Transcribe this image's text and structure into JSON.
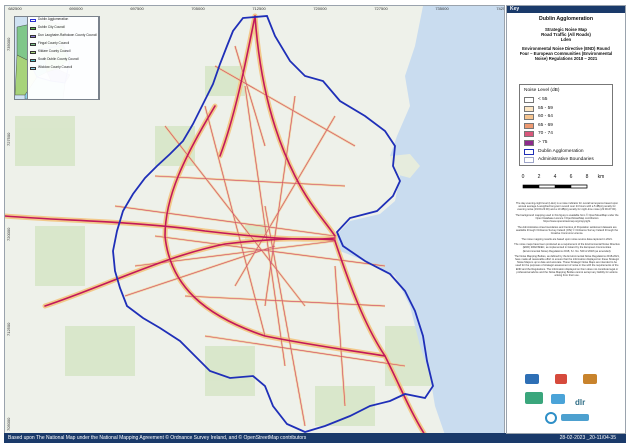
{
  "map": {
    "top_ticks": [
      "682500",
      "690000",
      "697500",
      "705000",
      "712500",
      "720000",
      "727500",
      "735000",
      "742500"
    ],
    "left_ticks": [
      "735000",
      "727500",
      "720000",
      "712500",
      "705000"
    ],
    "colors": {
      "land": "#eef1ea",
      "sea": "#c9dcef",
      "green": "#d4e5c4",
      "road_halo": "#f2c98a",
      "road_main": "#c2185b",
      "boundary": "#1f2fb8"
    }
  },
  "inset": {
    "items": [
      {
        "label": "Dublin Agglomeration",
        "color": "#2a2fcf"
      },
      {
        "label": "Dublin City Council",
        "color": "#66bb55"
      },
      {
        "label": "Dun Laoghaire-Rathdown County Council",
        "color": "#8a7bd8"
      },
      {
        "label": "Fingal County Council",
        "color": "#7fc78a"
      },
      {
        "label": "Kildare County Council",
        "color": "#a7d37a"
      },
      {
        "label": "South Dublin County Council",
        "color": "#55c3c9"
      },
      {
        "label": "Wicklow County Council",
        "color": "#8fd3e8"
      }
    ]
  },
  "bottom": {
    "credit": "Based upon The National Map under the National Mapping Agreement © Ordnance Survey Ireland, and © OpenStreetMap contributors",
    "date": "28-02-2023   _20-11/04-35"
  },
  "key": {
    "header": "Key",
    "title": "Dublin Agglomeration",
    "subtitle_lines": [
      "Strategic Noise Map",
      "Road Traffic (All Roads)",
      "Lden"
    ],
    "directive_lines": [
      "Environmental Noise Directive (END) Round",
      "Four – European Communities (Environmental",
      "Noise) Regulations 2018 – 2021"
    ],
    "legend_title": "Noise Level (dB)",
    "legend": [
      {
        "label": "< 55",
        "color": "#ffffff"
      },
      {
        "label": "55 - 59",
        "color": "#fde6c3"
      },
      {
        "label": "60 - 64",
        "color": "#f6c48f"
      },
      {
        "label": "65 - 69",
        "color": "#ee9a72"
      },
      {
        "label": "70 - 74",
        "color": "#d9577b"
      },
      {
        "label": "> 75",
        "color": "#8e2a8c"
      },
      {
        "label": "Dublin Agglomeration",
        "color": "#1f2fb8"
      },
      {
        "label": "Administrative Boundaries",
        "color": "#9fa6c9"
      }
    ],
    "scale_labels": [
      "0",
      "2",
      "4",
      "6",
      "8",
      "km"
    ],
    "notes": [
      "The day-evening-night level (Lden) is a noise indicator for overall annoyance based upon annual average A-weighted long-term sound over 24 hours with a 5 dB(A) penalty for evening noise (19:00-23:00) and a 10 dB(A) penalty for night-time noise (23:00-07:00).",
      "The background mapping used in this figure is available from © OpenStreetMap under the Open Database Licence ©OpenStreetMap contributors https://www.openstreetmap.org/copyright.",
      "The Administrative Area boundaries and Centres of Population settlement datasets are available through Ordnance Survey Ireland (OSi) © Ordnance Survey Ireland through the Creative Commons Licence.",
      "The noise mapping results are based upon noise source data captured in 2021.",
      "The noise maps have been produced as a requirement of the Environmental Noise Directive (END) 2002/49/EC, as implemented in Ireland by the European Communities (Environmental Noise) Regulations 2018, S.I. No. 549 of 2018 (as amended).",
      "The Noise Mapping Bodies, as defined by the Environmental Noise Regulations 2018-2021, have made all reasonable effort to ensure that the information displayed on these Strategic Noise Maps is up to date and accurate. These Strategic Noise Maps are intended to be used for the purposes of strategic assessment of noise in line with the requirements of the END and the Regulations. The information displayed on them does not constitute legal or professional advice and the Noise Mapping Bodies cannot accept any liability for actions arising from their use."
    ],
    "logo_text": "dlr"
  }
}
